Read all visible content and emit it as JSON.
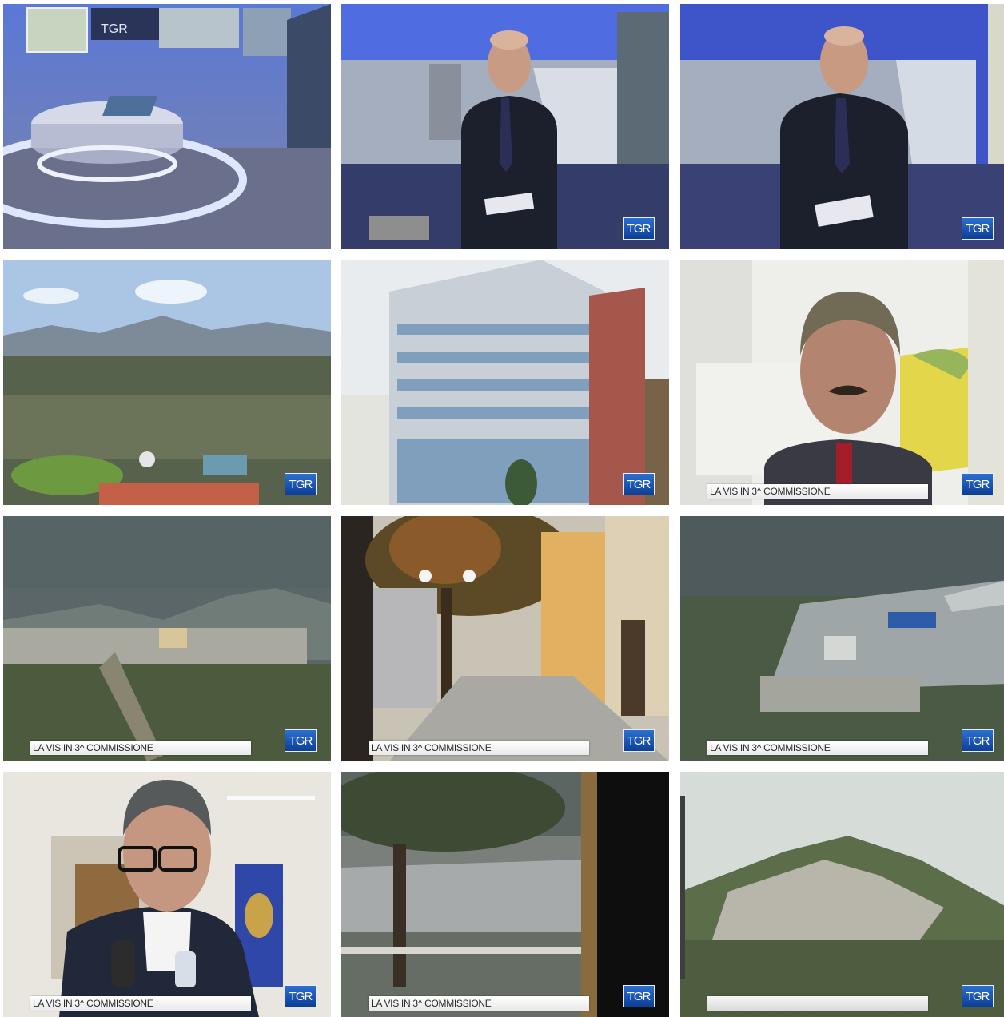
{
  "frames": [
    {
      "id": "1",
      "scene": "studio-desk",
      "logo": "TGR",
      "caption": ""
    },
    {
      "id": "2",
      "scene": "anchor-standing",
      "logo": "TGR",
      "caption": ""
    },
    {
      "id": "3",
      "scene": "anchor-closeup",
      "logo": "TGR",
      "caption": ""
    },
    {
      "id": "4",
      "scene": "valley-aerial",
      "logo": "TGR",
      "caption": ""
    },
    {
      "id": "5",
      "scene": "office-building",
      "logo": "TGR",
      "caption": ""
    },
    {
      "id": "6",
      "scene": "interview-man-mustache",
      "logo": "TGR",
      "caption": "LA VIS IN 3^ COMMISSIONE"
    },
    {
      "id": "7",
      "scene": "hill-town",
      "logo": "TGR",
      "caption": "LA VIS IN 3^ COMMISSIONE"
    },
    {
      "id": "8",
      "scene": "street-tree",
      "logo": "TGR",
      "caption": "LA VIS IN 3^ COMMISSIONE"
    },
    {
      "id": "9",
      "scene": "industrial-plant",
      "logo": "TGR",
      "caption": "LA VIS IN 3^ COMMISSIONE"
    },
    {
      "id": "10",
      "scene": "interview-man-glasses",
      "logo": "TGR",
      "caption": "LA VIS IN 3^ COMMISSIONE"
    },
    {
      "id": "11",
      "scene": "tree-balcony-view",
      "logo": "TGR",
      "caption": "LA VIS IN 3^ COMMISSIONE"
    },
    {
      "id": "12",
      "scene": "mountain-town",
      "logo": "TGR",
      "caption": ""
    }
  ],
  "colors": {
    "logo_blue": "#1a55b8",
    "studio_blue": "#4a5fd8",
    "sky": "#cfe3f4"
  }
}
